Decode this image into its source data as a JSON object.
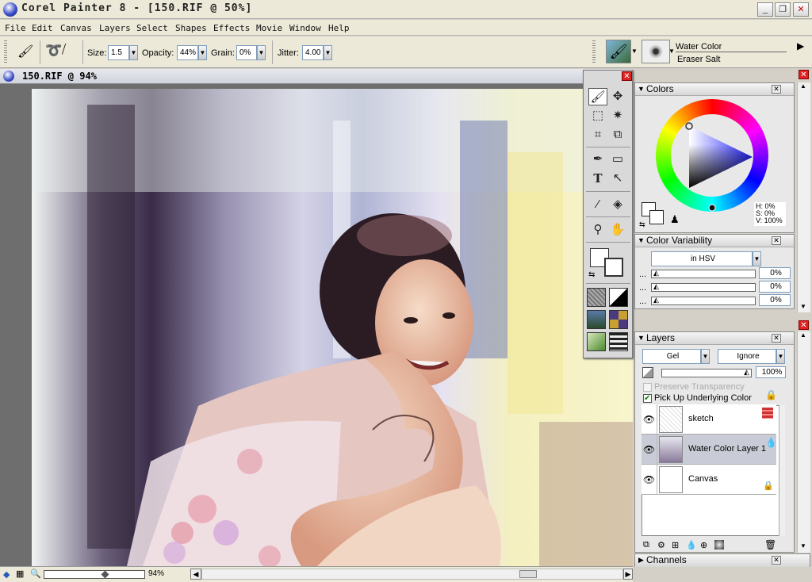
{
  "app": {
    "title": "Corel Painter 8 - [150.RIF @ 50%]",
    "controls": [
      "_",
      "❐",
      "✕"
    ]
  },
  "menu": [
    "File",
    "Edit",
    "Canvas",
    "Layers",
    "Select",
    "Shapes",
    "Effects",
    "Movie",
    "Window",
    "Help"
  ],
  "propbar": {
    "size_label": "Size:",
    "size_value": "1.5",
    "opacity_label": "Opacity:",
    "opacity_value": "44%",
    "grain_label": "Grain:",
    "grain_value": "0%",
    "jitter_label": "Jitter:",
    "jitter_value": "4.00",
    "brush_category": "Water Color",
    "brush_variant": "Eraser Salt"
  },
  "document": {
    "title": "150.RIF @ 94%",
    "zoom": "94%"
  },
  "colors": {
    "title": "Colors",
    "h": "H: 0%",
    "s": "S: 0%",
    "v": "V: 100%"
  },
  "color_variability": {
    "title": "Color Variability",
    "mode": "in HSV",
    "rows": [
      {
        "label": "...",
        "value": "0%"
      },
      {
        "label": "...",
        "value": "0%"
      },
      {
        "label": "...",
        "value": "0%"
      }
    ]
  },
  "layers": {
    "title": "Layers",
    "composite_method": "Gel",
    "depth": "Ignore",
    "opacity": "100%",
    "preserve_transparency": "Preserve Transparency",
    "pick_up_underlying": "Pick Up Underlying Color",
    "items": [
      {
        "name": "sketch"
      },
      {
        "name": "Water Color Layer 1"
      },
      {
        "name": "Canvas"
      }
    ]
  },
  "channels": {
    "title": "Channels"
  },
  "theme": {
    "accent": "#316ac5",
    "title_bg": "#ece9d8"
  }
}
